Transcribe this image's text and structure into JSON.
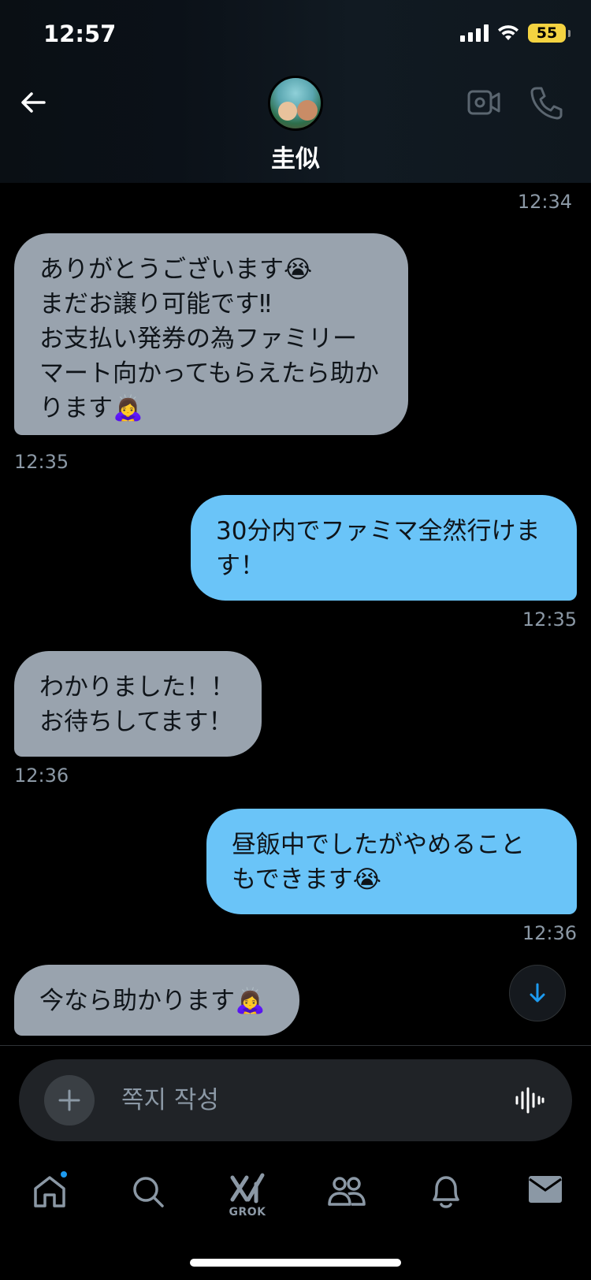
{
  "status_bar": {
    "time": "12:57",
    "battery": "55"
  },
  "header": {
    "contact_name": "圭似"
  },
  "messages": [
    {
      "from": "them",
      "time_above": "12:34",
      "lines": [
        "ありがとうございます😭",
        "まだお譲り可能です‼︎",
        "お支払い発券の為ファミリー",
        "マート向かってもらえたら助か",
        "ります🙇‍♀️"
      ],
      "time": "12:35"
    },
    {
      "from": "me",
      "lines": [
        "30分内でファミマ全然行けま",
        "す！"
      ],
      "time": "12:35"
    },
    {
      "from": "them",
      "lines": [
        "わかりました！！",
        "お待ちしてます！"
      ],
      "time": "12:36"
    },
    {
      "from": "me",
      "lines": [
        "昼飯中でしたがやめること",
        "もできます😭"
      ],
      "time": "12:36"
    },
    {
      "from": "them",
      "lines": [
        "今なら助かります🙇‍♀️"
      ]
    }
  ],
  "composer": {
    "placeholder": "쪽지 작성"
  },
  "tabbar": {
    "grok_label": "GROK"
  },
  "colors": {
    "received_bubble": "#99a3ae",
    "sent_bubble": "#6ac4f8",
    "accent": "#1d9bf0"
  },
  "icons": [
    "back-arrow-icon",
    "video-call-icon",
    "phone-icon",
    "arrow-down-icon",
    "plus-icon",
    "voice-waveform-icon",
    "home-icon",
    "search-icon",
    "grok-icon",
    "communities-icon",
    "notifications-bell-icon",
    "messages-envelope-icon"
  ]
}
